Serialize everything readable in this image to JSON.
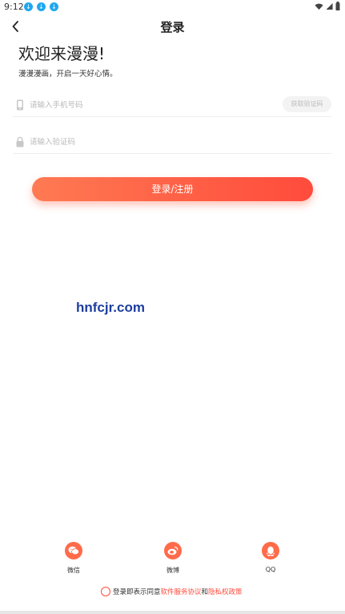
{
  "status_bar": {
    "time": "9:12"
  },
  "nav": {
    "title": "登录"
  },
  "welcome": {
    "title": "欢迎来漫漫!",
    "subtitle": "漫漫漫画，开启一天好心情。"
  },
  "form": {
    "phone_placeholder": "请输入手机号码",
    "get_code_label": "获取验证码",
    "code_placeholder": "请输入验证码",
    "submit_label": "登录/注册"
  },
  "watermark": "hnfcjr.com",
  "social": {
    "wechat": "微信",
    "weibo": "微博",
    "qq": "QQ"
  },
  "agreement": {
    "prefix": "登录即表示同意",
    "terms_link": "软件服务协议",
    "joiner": "和",
    "privacy_link": "隐私权政策"
  },
  "colors": {
    "accent": "#ff4b3c",
    "accent_start": "#ff7a52",
    "notification": "#22a7f0"
  }
}
